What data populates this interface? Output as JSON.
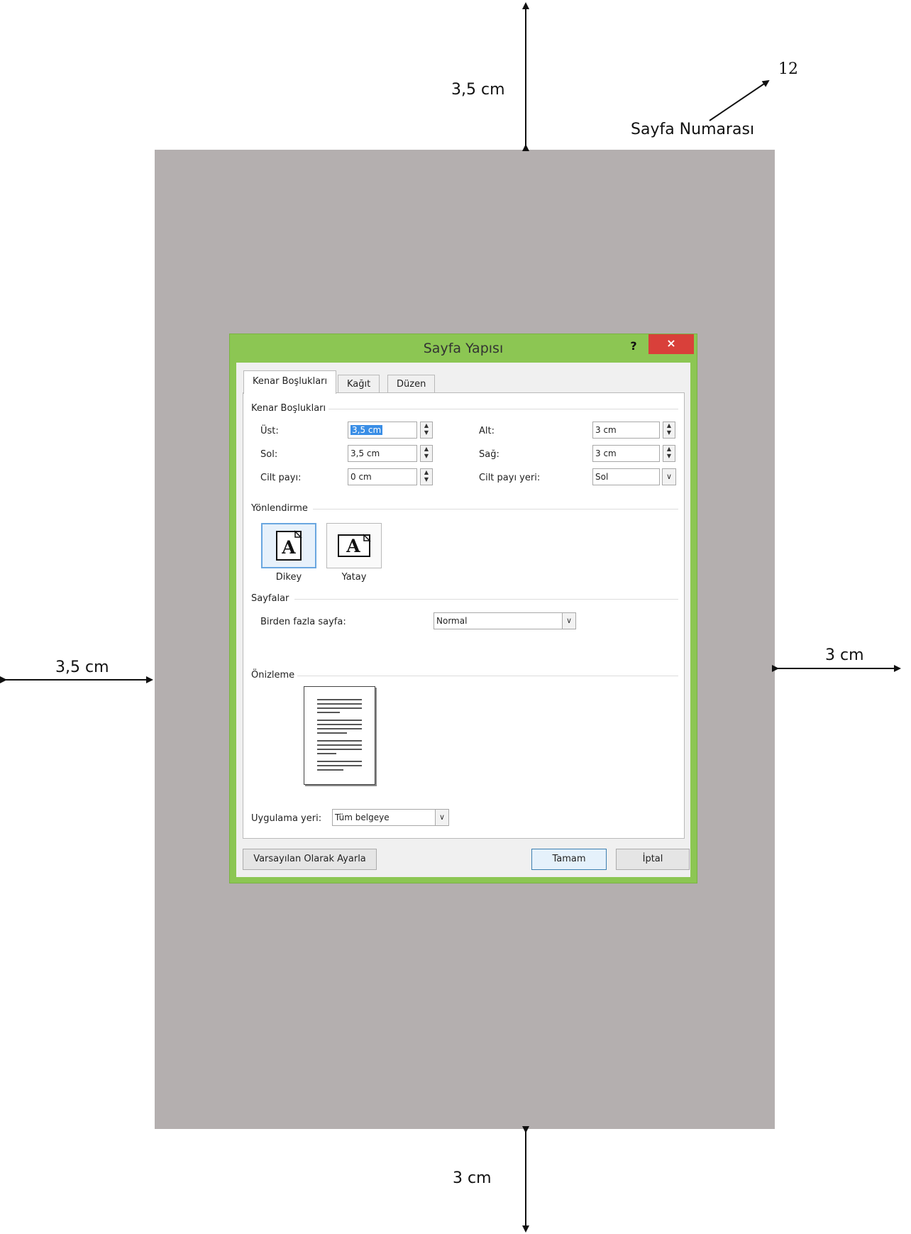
{
  "annotations": {
    "top_margin": "3,5 cm",
    "left_margin": "3,5 cm",
    "right_margin": "3 cm",
    "bottom_margin": "3 cm",
    "page_number_value": "12",
    "page_number_label": "Sayfa Numarası"
  },
  "dialog": {
    "title": "Sayfa Yapısı",
    "help": "?",
    "close": "×",
    "tabs": [
      "Kenar Boşlukları",
      "Kağıt",
      "Düzen"
    ],
    "margins_group": "Kenar Boşlukları",
    "fields": {
      "ust_label": "Üst:",
      "ust_value": "3,5 cm",
      "alt_label": "Alt:",
      "alt_value": "3 cm",
      "sol_label": "Sol:",
      "sol_value": "3,5 cm",
      "sag_label": "Sağ:",
      "sag_value": "3 cm",
      "cilt_payi_label": "Cilt payı:",
      "cilt_payi_value": "0 cm",
      "cilt_payi_yeri_label": "Cilt payı yeri:",
      "cilt_payi_yeri_value": "Sol"
    },
    "orientation_group": "Yönlendirme",
    "orientation_options": [
      "Dikey",
      "Yatay"
    ],
    "orientation_selected": "Dikey",
    "pages_group": "Sayfalar",
    "multiple_pages_label": "Birden fazla sayfa:",
    "multiple_pages_value": "Normal",
    "preview_group": "Önizleme",
    "apply_to_label": "Uygulama yeri:",
    "apply_to_value": "Tüm belgeye",
    "buttons": {
      "set_default": "Varsayılan Olarak Ayarla",
      "ok": "Tamam",
      "cancel": "İptal"
    }
  },
  "colors": {
    "page_background": "#b4afaf",
    "dialog_frame": "#8cc653",
    "close_button": "#d9403a",
    "selection": "#3a8ee6"
  }
}
